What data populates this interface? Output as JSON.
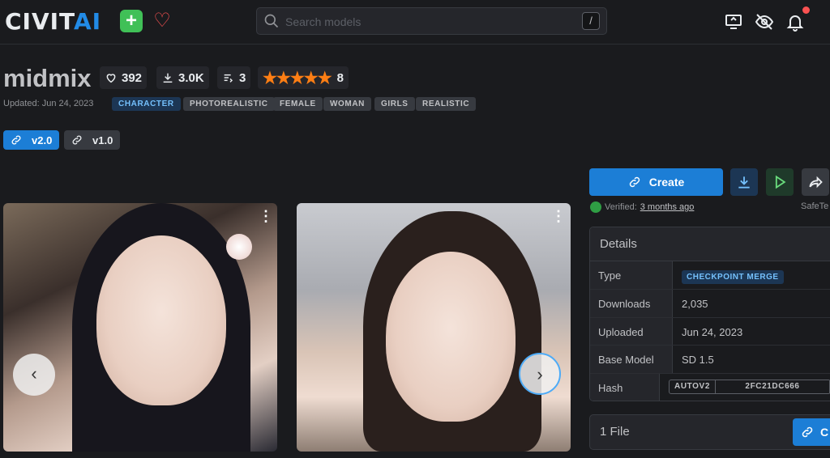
{
  "header": {
    "logo_left": "CIVIT",
    "logo_right": "AI",
    "search_placeholder": "Search models",
    "search_shortcut": "/"
  },
  "model": {
    "title": "midmix",
    "likes": "392",
    "downloads": "3.0K",
    "versions_count": "3",
    "rating_count": "8",
    "stars": "★★★★★",
    "updated": "Updated: Jun 24, 2023",
    "tags": [
      "CHARACTER",
      "PHOTOREALISTIC",
      "FEMALE",
      "WOMAN",
      "GIRLS",
      "REALISTIC"
    ],
    "versions": [
      "v2.0",
      "v1.0"
    ]
  },
  "actions": {
    "create_label": "Create",
    "verified_label": "Verified:",
    "verified_time": "3 months ago",
    "safetensor_label": "SafeTe"
  },
  "details": {
    "heading": "Details",
    "rows": [
      {
        "key": "Type",
        "value": "CHECKPOINT MERGE"
      },
      {
        "key": "Downloads",
        "value": "2,035"
      },
      {
        "key": "Uploaded",
        "value": "Jun 24, 2023"
      },
      {
        "key": "Base Model",
        "value": "SD 1.5"
      },
      {
        "key": "Hash",
        "value": "AUTOV2",
        "hash": "2FC21DC666"
      }
    ]
  },
  "files": {
    "label": "1 File",
    "button_fragment": "C"
  },
  "colors": {
    "accent": "#1c7ed6",
    "plus": "#40c057",
    "heart": "#fa5252",
    "star": "#fd7e14"
  }
}
